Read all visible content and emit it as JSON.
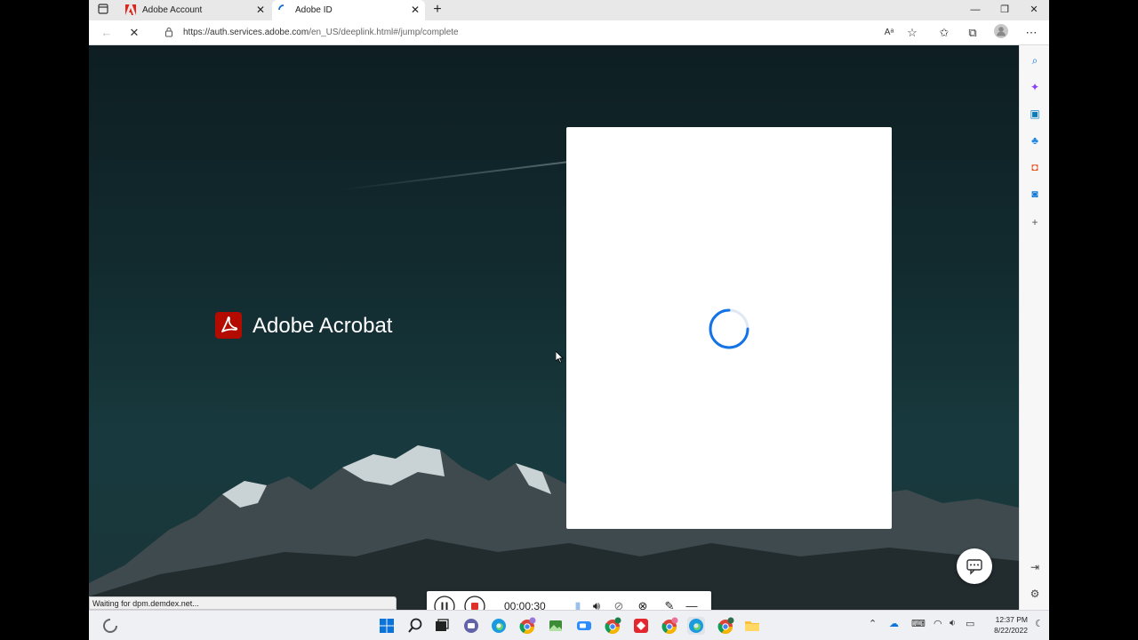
{
  "tabs": [
    {
      "title": "Adobe Account",
      "active": false
    },
    {
      "title": "Adobe ID",
      "active": true
    }
  ],
  "toolbar": {
    "url_host": "https://auth.services.adobe.com",
    "url_path": "/en_US/deeplink.html#/jump/complete"
  },
  "page": {
    "brand_name": "Adobe Acrobat",
    "status_text": "Waiting for dpm.demdex.net..."
  },
  "recorder": {
    "elapsed": "00:00:30"
  },
  "taskbar": {
    "time": "12:37 PM",
    "date": "8/22/2022"
  },
  "colors": {
    "adobe_red": "#b30b00",
    "spinner_blue": "#1473e6",
    "edge_blue": "#0c6fd6"
  }
}
